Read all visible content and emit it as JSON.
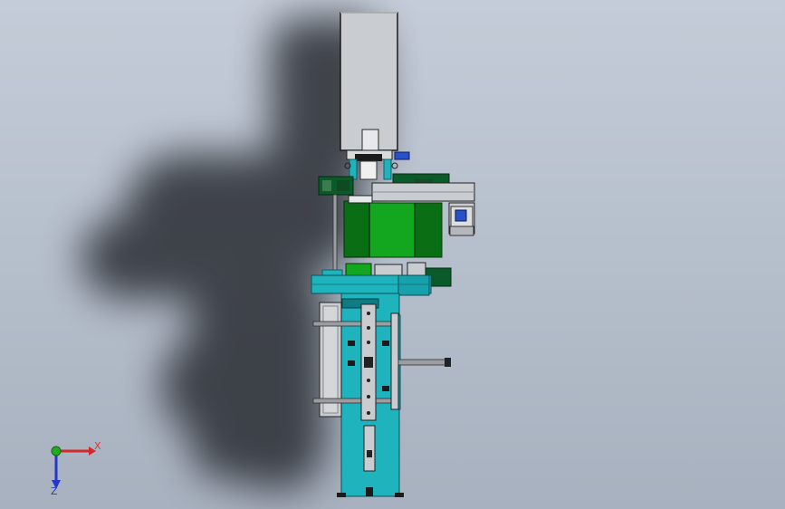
{
  "app": {
    "view": "cad-graphics-area"
  },
  "triad": {
    "x_label": "X",
    "z_label": "Z",
    "x_color": "#d22a2a",
    "y_color": "#22aa22",
    "z_color": "#2438c8"
  },
  "colors": {
    "background_top": "#c4ccd8",
    "background_bottom": "#a8b1bf",
    "frame_cyan": "#1fb4bd",
    "motor_green": "#0c8a18",
    "housing_grey": "#c9ccd0",
    "dark_green": "#0b5a2a",
    "motor_blue": "#2850c8"
  }
}
